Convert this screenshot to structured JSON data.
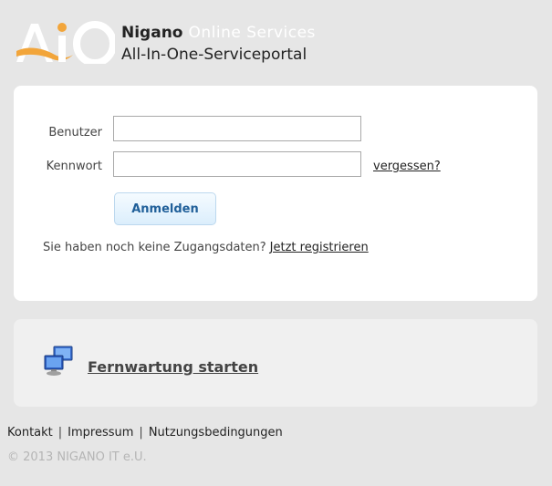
{
  "brand": {
    "logo_icon": "aio-logo-icon",
    "name": "Nigano",
    "subtitle": "Online Services",
    "tagline": "All-In-One-Serviceportal",
    "colors": {
      "logo_orange": "#f2a53a",
      "logo_white": "#ffffff"
    }
  },
  "login": {
    "user_label": "Benutzer",
    "user_value": "",
    "password_label": "Kennwort",
    "password_value": "",
    "forgot_link": "vergessen?",
    "submit_label": "Anmelden",
    "register_text": "Sie haben noch keine Zugangsdaten?",
    "register_link": "Jetzt registrieren"
  },
  "remote": {
    "icon": "remote-computer-icon",
    "link": "Fernwartung starten"
  },
  "footer": {
    "links": [
      "Kontakt",
      "Impressum",
      "Nutzungsbedingungen"
    ],
    "copyright": "© 2013 NIGANO IT e.U."
  }
}
